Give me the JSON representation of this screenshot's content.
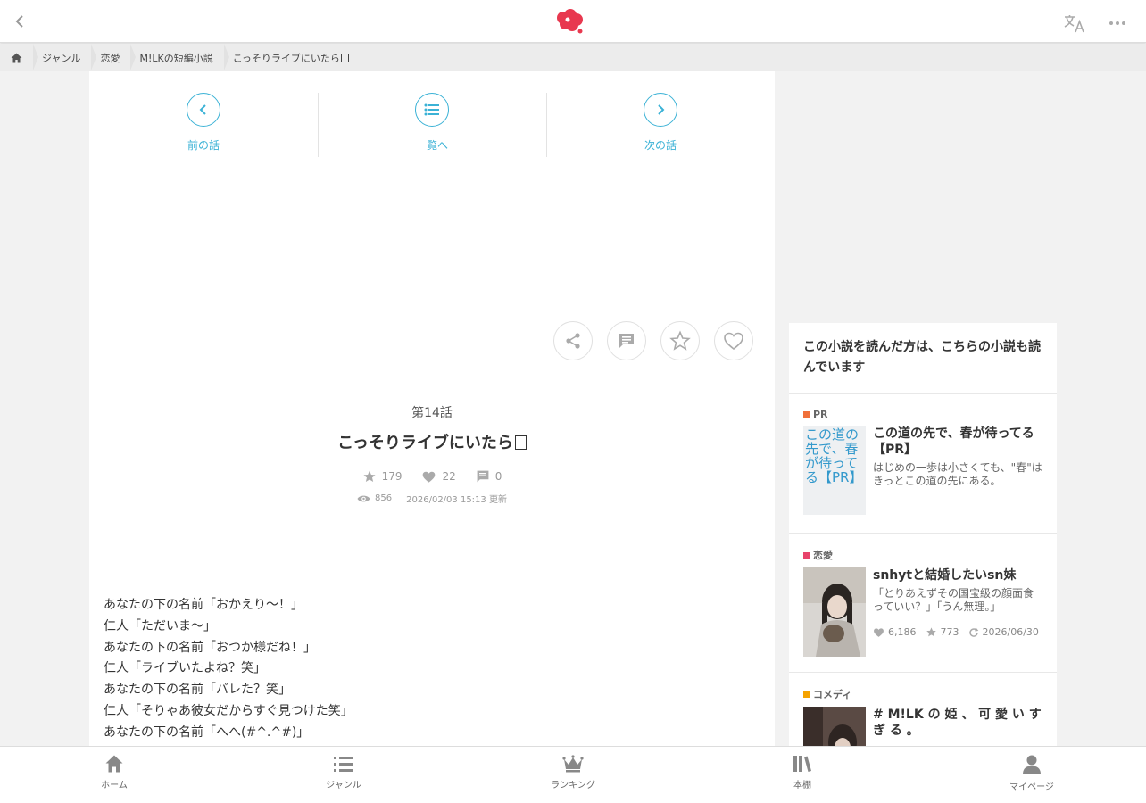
{
  "breadcrumb": {
    "items": [
      "ジャンル",
      "恋愛",
      "M!LKの短編小説",
      "こっそりライブにいたら"
    ]
  },
  "episode_nav": {
    "prev_label": "前の話",
    "list_label": "一覧へ",
    "next_label": "次の話"
  },
  "episode": {
    "number": "第14話",
    "title": "こっそりライブにいたら",
    "stars": "179",
    "hearts": "22",
    "comments": "0",
    "views": "856",
    "updated": "2026/02/03 15:13 更新"
  },
  "body_lines": [
    "あなたの下の名前「おかえり〜！」",
    "仁人「ただいま〜」",
    "あなたの下の名前「おつか様だね！」",
    "仁人「ライブいたよね？笑」",
    "あなたの下の名前「バレた？笑」",
    "仁人「そりゃあ彼女だからすぐ見つけた笑」",
    "あなたの下の名前「へへ(#^.^#)」"
  ],
  "sidebar": {
    "heading": "この小説を読んだ方は、こちらの小説も読んでいます",
    "recommendations": [
      {
        "genre": "PR",
        "genre_color": "#f0703a",
        "title": "この道の先で、春が待ってる【PR】",
        "thumb_alt": "この道の先で、春が待ってる【PR】",
        "description": "はじめの一歩は小さくても、\"春\"はきっとこの道の先にある。"
      },
      {
        "genre": "恋愛",
        "genre_color": "#e8436b",
        "title": "snhytと結婚したいsn妹",
        "description": "「とりあえずその国宝級の顔面食っていい？」「うん無理。」",
        "hearts": "6,186",
        "stars": "773",
        "date": "2026/06/30"
      },
      {
        "genre": "コメディ",
        "genre_color": "#f5a300",
        "title": "# M!LK の 姫 、 可 愛 い す ぎ る 。"
      }
    ]
  },
  "tabbar": {
    "home": "ホーム",
    "genre": "ジャンル",
    "ranking": "ランキング",
    "bookshelf": "本棚",
    "mypage": "マイページ"
  },
  "colors": {
    "accent": "#3bb2d6",
    "logo": "#e8384f"
  }
}
